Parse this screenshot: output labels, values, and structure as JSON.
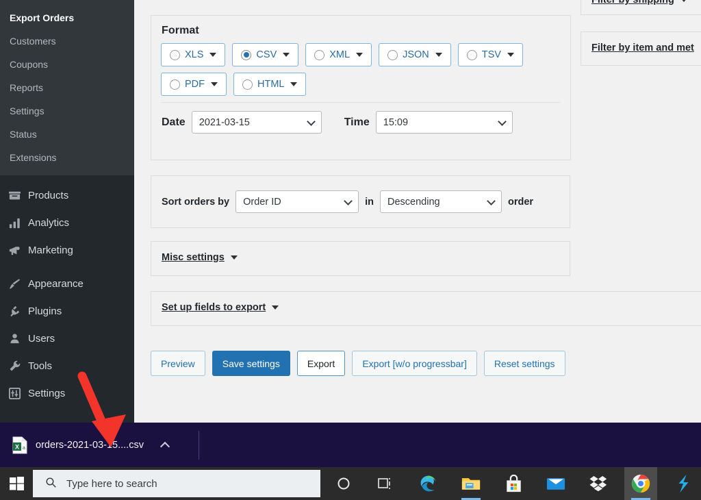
{
  "sidebar": {
    "submenu": [
      {
        "label": "Export Orders",
        "current": true
      },
      {
        "label": "Customers",
        "current": false
      },
      {
        "label": "Coupons",
        "current": false
      },
      {
        "label": "Reports",
        "current": false
      },
      {
        "label": "Settings",
        "current": false
      },
      {
        "label": "Status",
        "current": false
      },
      {
        "label": "Extensions",
        "current": false
      }
    ],
    "menu_group_1": [
      {
        "label": "Products",
        "icon": "products-icon"
      },
      {
        "label": "Analytics",
        "icon": "analytics-icon"
      },
      {
        "label": "Marketing",
        "icon": "marketing-megaphone-icon"
      }
    ],
    "menu_group_2": [
      {
        "label": "Appearance",
        "icon": "appearance-brush-icon"
      },
      {
        "label": "Plugins",
        "icon": "plugins-plug-icon"
      },
      {
        "label": "Users",
        "icon": "users-person-icon"
      },
      {
        "label": "Tools",
        "icon": "tools-wrench-icon"
      },
      {
        "label": "Settings",
        "icon": "settings-sliders-icon"
      }
    ]
  },
  "format_panel": {
    "title": "Format",
    "options_row1": [
      {
        "label": "XLS",
        "selected": false
      },
      {
        "label": "CSV",
        "selected": true
      },
      {
        "label": "XML",
        "selected": false
      },
      {
        "label": "JSON",
        "selected": false
      },
      {
        "label": "TSV",
        "selected": false
      }
    ],
    "options_row2": [
      {
        "label": "PDF",
        "selected": false
      },
      {
        "label": "HTML",
        "selected": false
      }
    ],
    "date_label": "Date",
    "date_value": "2021-03-15",
    "time_label": "Time",
    "time_value": "15:09"
  },
  "sort_panel": {
    "prefix_label": "Sort orders by",
    "field_value": "Order ID",
    "middle_label": "in",
    "direction_value": "Descending",
    "suffix_label": "order"
  },
  "collapsibles": {
    "misc": "Misc settings",
    "fields": "Set up fields to export",
    "filter_shipping": "Filter by shipping",
    "filter_item": "Filter by item and met"
  },
  "buttons": [
    {
      "label": "Preview",
      "style": "default"
    },
    {
      "label": "Save settings",
      "style": "primary"
    },
    {
      "label": "Export",
      "style": "strong"
    },
    {
      "label": "Export [w/o progressbar]",
      "style": "default"
    },
    {
      "label": "Reset settings",
      "style": "default"
    }
  ],
  "download_bar": {
    "file_name": "orders-2021-03-15....csv",
    "file_icon": "excel-csv-file-icon",
    "menu_icon": "chevron-up-icon"
  },
  "taskbar": {
    "start_icon": "windows-start-icon",
    "search_placeholder": "Type here to search",
    "search_icon": "search-icon",
    "items": [
      {
        "name": "cortana-icon"
      },
      {
        "name": "task-view-icon"
      },
      {
        "name": "edge-browser-icon"
      },
      {
        "name": "file-explorer-icon"
      },
      {
        "name": "microsoft-store-icon"
      },
      {
        "name": "mail-icon"
      },
      {
        "name": "dropbox-icon"
      },
      {
        "name": "chrome-browser-icon"
      },
      {
        "name": "snagit-icon"
      }
    ]
  },
  "colors": {
    "sidebar_bg": "#23282d",
    "submenu_bg": "#32373c",
    "accent_blue": "#2271b1",
    "download_bar_bg": "#1b1140",
    "annotation_red": "#f3342b"
  }
}
